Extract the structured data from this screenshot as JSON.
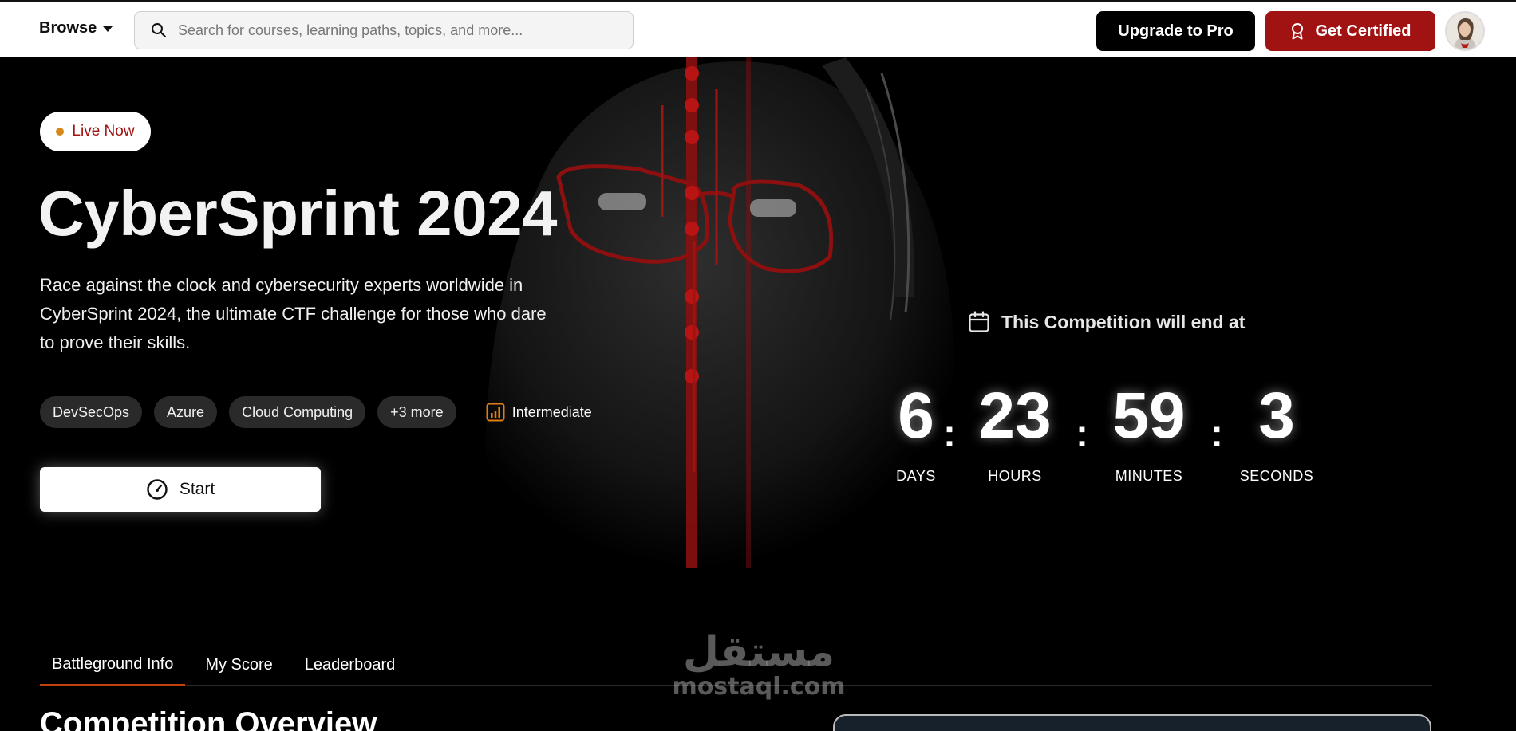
{
  "header": {
    "browse_label": "Browse",
    "search_placeholder": "Search for courses, learning paths, topics, and more...",
    "upgrade_label": "Upgrade to Pro",
    "certified_label": "Get Certified"
  },
  "hero": {
    "badge": "Live Now",
    "title": "CyberSprint 2024",
    "description": "Race against the clock and cybersecurity experts worldwide in CyberSprint 2024, the ultimate CTF challenge for those who dare to prove their skills.",
    "tags": [
      "DevSecOps",
      "Azure",
      "Cloud Computing",
      "+3 more"
    ],
    "level": "Intermediate",
    "start_label": "Start"
  },
  "countdown": {
    "heading": "This Competition will end at",
    "units": [
      {
        "value": "6",
        "label": "DAYS"
      },
      {
        "value": "23",
        "label": "HOURS"
      },
      {
        "value": "59",
        "label": "MINUTES"
      },
      {
        "value": "3",
        "label": "SECONDS"
      }
    ],
    "separator": ":"
  },
  "tabs": [
    "Battleground Info",
    "My Score",
    "Leaderboard"
  ],
  "overview_title": "Competition Overview",
  "watermark": {
    "arabic": "مستقل",
    "latin": "mostaql.com"
  },
  "colors": {
    "brand_red": "#a11212",
    "live_dot": "#d4891a",
    "tab_underline": "#c2410c",
    "level_icon": "#e07b16"
  }
}
